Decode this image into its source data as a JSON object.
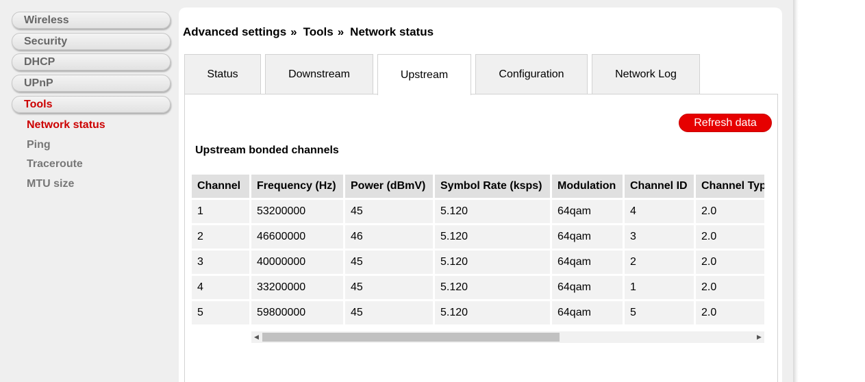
{
  "sidebar": {
    "menu": [
      {
        "label": "Wireless"
      },
      {
        "label": "Security"
      },
      {
        "label": "DHCP"
      },
      {
        "label": "UPnP"
      },
      {
        "label": "Tools"
      }
    ],
    "submenu": [
      {
        "label": "Network status"
      },
      {
        "label": "Ping"
      },
      {
        "label": "Traceroute"
      },
      {
        "label": "MTU size"
      }
    ],
    "active_menu": "Tools",
    "active_submenu": "Network status"
  },
  "breadcrumb": {
    "parts": [
      "Advanced settings",
      "Tools",
      "Network status"
    ],
    "separator": "»"
  },
  "tabs": [
    {
      "label": "Status"
    },
    {
      "label": "Downstream"
    },
    {
      "label": "Upstream"
    },
    {
      "label": "Configuration"
    },
    {
      "label": "Network Log"
    }
  ],
  "active_tab": "Upstream",
  "refresh_label": "Refresh data",
  "section_title": "Upstream bonded channels",
  "table": {
    "headers": [
      "Channel",
      "Frequency (Hz)",
      "Power (dBmV)",
      "Symbol Rate (ksps)",
      "Modulation",
      "Channel ID",
      "Channel Type"
    ],
    "rows": [
      [
        "1",
        "53200000",
        "45",
        "5.120",
        "64qam",
        "4",
        "2.0"
      ],
      [
        "2",
        "46600000",
        "46",
        "5.120",
        "64qam",
        "3",
        "2.0"
      ],
      [
        "3",
        "40000000",
        "45",
        "5.120",
        "64qam",
        "2",
        "2.0"
      ],
      [
        "4",
        "33200000",
        "45",
        "5.120",
        "64qam",
        "1",
        "2.0"
      ],
      [
        "5",
        "59800000",
        "45",
        "5.120",
        "64qam",
        "5",
        "2.0"
      ]
    ]
  },
  "scrollbar": {
    "left_arrow": "◀",
    "right_arrow": "▶"
  },
  "colors": {
    "accent": "#e60000",
    "active_text": "#cc0000"
  }
}
